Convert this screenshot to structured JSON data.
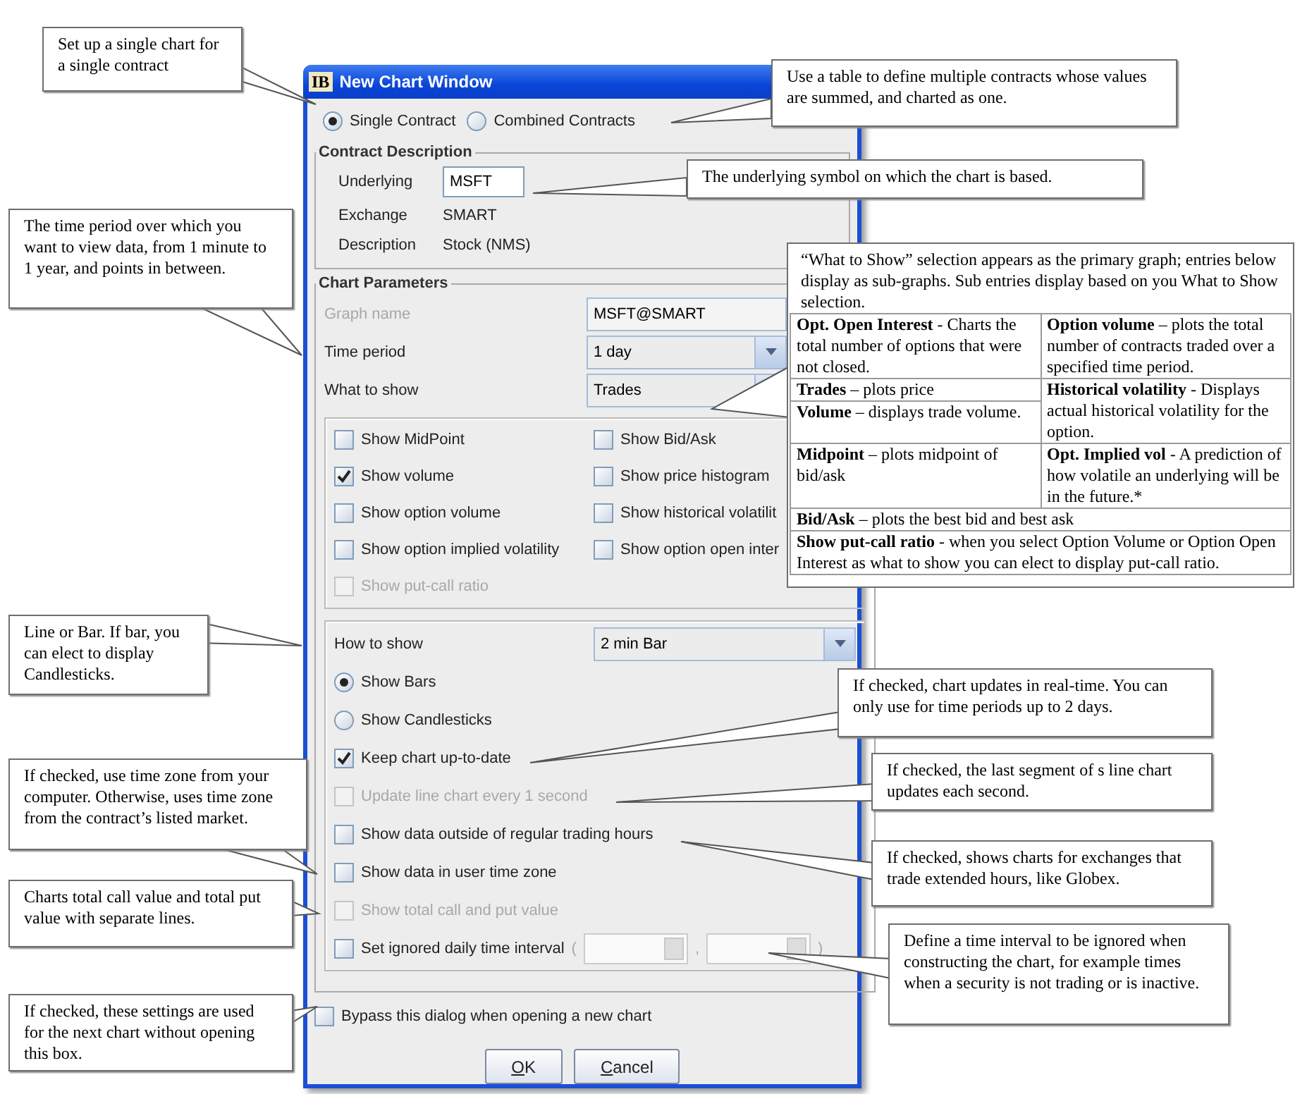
{
  "window": {
    "title": "New Chart Window",
    "icon_text": "IB"
  },
  "mode_options": [
    {
      "label": "Single Contract",
      "selected": true
    },
    {
      "label": "Combined Contracts",
      "selected": false
    }
  ],
  "contract_description": {
    "title": "Contract Description",
    "underlying_label": "Underlying",
    "underlying_value": "MSFT",
    "rows": [
      {
        "label": "Exchange",
        "value": "SMART"
      },
      {
        "label": "Description",
        "value": "Stock (NMS)"
      }
    ]
  },
  "chart_parameters": {
    "title": "Chart Parameters",
    "fields": [
      {
        "label": "Graph name",
        "value": "MSFT@SMART",
        "disabled": true
      },
      {
        "label": "Time period",
        "value": "1 day",
        "disabled": false
      },
      {
        "label": "What to show",
        "value": "Trades",
        "disabled": false
      }
    ],
    "studies": [
      {
        "label": "Show MidPoint",
        "checked": false,
        "disabled": false
      },
      {
        "label": "Show Bid/Ask",
        "checked": false,
        "disabled": false
      },
      {
        "label": "Show volume",
        "checked": true,
        "disabled": false
      },
      {
        "label": "Show price histogram",
        "checked": false,
        "disabled": false
      },
      {
        "label": "Show option volume",
        "checked": false,
        "disabled": false
      },
      {
        "label": "Show historical volatilit",
        "checked": false,
        "disabled": false
      },
      {
        "label": "Show option implied volatility",
        "checked": false,
        "disabled": false
      },
      {
        "label": "Show option open inter",
        "checked": false,
        "disabled": false
      },
      {
        "label": "Show put-call ratio",
        "checked": false,
        "disabled": true
      }
    ],
    "how_to_show": {
      "label": "How to show",
      "value": "2 min Bar"
    },
    "bar_styles": [
      {
        "label": "Show Bars",
        "selected": true
      },
      {
        "label": "Show Candlesticks",
        "selected": false
      }
    ],
    "options": [
      {
        "label": "Keep chart up-to-date",
        "checked": true,
        "disabled": false
      },
      {
        "label": "Update line chart every 1 second",
        "checked": false,
        "disabled": true
      },
      {
        "label": "Show data outside of regular trading hours",
        "checked": false,
        "disabled": false
      },
      {
        "label": "Show data in user time zone",
        "checked": false,
        "disabled": false
      },
      {
        "label": "Show total call and put value",
        "checked": false,
        "disabled": true
      },
      {
        "label": "Set ignored daily time interval",
        "checked": false,
        "disabled": false
      }
    ],
    "interval": {
      "open": "(",
      "separator": ",",
      "close": ")"
    }
  },
  "bypass": {
    "label": "Bypass this dialog when opening a new chart",
    "checked": false
  },
  "buttons": [
    "OK",
    "Cancel"
  ],
  "callouts": [
    {
      "kind": "note",
      "text": "Set up a single chart for a single contract"
    },
    {
      "kind": "note",
      "text": "Use a table to define multiple contracts whose values are summed, and charted as one."
    },
    {
      "kind": "note",
      "text": "The underlying symbol on which the chart is based."
    },
    {
      "kind": "note",
      "text": "The time period over which you want to view data, from 1 minute to 1 year, and points in between."
    },
    {
      "kind": "table",
      "intro": "“What to Show” selection appears as the primary graph; entries below display as sub-graphs. Sub entries display based on you What to Show selection.",
      "rows": [
        {
          "kind": "split",
          "left": [
            "**Opt. Open Interest** - Charts the total number of options that were not closed."
          ],
          "right": "**Option volume** – plots the total number of contracts traded over a specified time period."
        },
        {
          "kind": "split",
          "left": [
            "**Trades** – plots price",
            "**Volume** – displays trade volume."
          ],
          "right": "**Historical volatility** - Displays actual historical volatility for the option."
        },
        {
          "kind": "split",
          "left": [
            "**Midpoint** – plots midpoint of bid/ask"
          ],
          "right": "**Opt. Implied vol** - A prediction of how volatile an underlying will be in the future.*"
        },
        {
          "kind": "full",
          "text": "**Bid/Ask** – plots the best bid and best ask"
        },
        {
          "kind": "full",
          "text": "**Show put-call ratio** - when you select Option Volume or Option Open Interest as what to show you can elect to display put-call ratio."
        }
      ]
    },
    {
      "kind": "note",
      "text": "Line or Bar. If bar, you can elect to display Candlesticks."
    },
    {
      "kind": "note",
      "text": "If checked, chart updates in real-time. You can only use for time periods up to 2 days."
    },
    {
      "kind": "note",
      "text": "If checked, use time zone from your computer. Otherwise, uses time zone from the contract’s listed market."
    },
    {
      "kind": "note",
      "text": "If checked, the last segment of s line chart updates each second."
    },
    {
      "kind": "note",
      "text": "If checked, shows charts for exchanges that trade extended hours, like Globex."
    },
    {
      "kind": "note",
      "text": "Charts total call value and total put value with separate lines."
    },
    {
      "kind": "note",
      "text": "Define a time interval to be ignored when constructing the chart, for example times when a security is not trading or is inactive."
    },
    {
      "kind": "note",
      "text": "If checked, these settings are used for the next chart without opening this box."
    }
  ]
}
